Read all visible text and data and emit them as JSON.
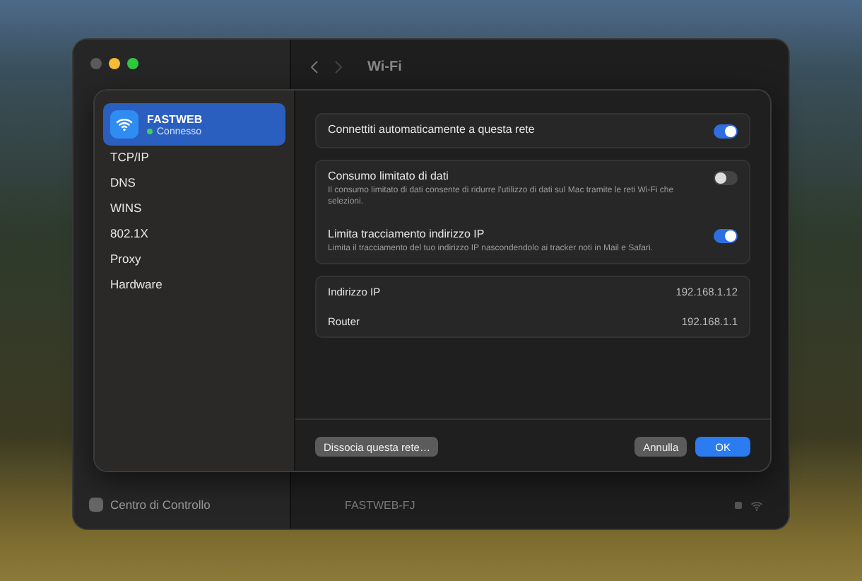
{
  "window": {
    "title": "Wi-Fi"
  },
  "background_sidebar": [
    {
      "label": "Centro di Controllo"
    }
  ],
  "background_networks": [
    {
      "name": "FASTWEB-FJ"
    }
  ],
  "sheet": {
    "network": {
      "name": "FASTWEB",
      "status": "Connesso",
      "selected": true
    },
    "nav": [
      {
        "label": "TCP/IP",
        "selected": false
      },
      {
        "label": "DNS",
        "selected": false
      },
      {
        "label": "WINS",
        "selected": false
      },
      {
        "label": "802.1X",
        "selected": false
      },
      {
        "label": "Proxy",
        "selected": false
      },
      {
        "label": "Hardware",
        "selected": false
      }
    ],
    "toggle_groups": [
      [
        {
          "title": "Connettiti automaticamente a questa rete",
          "on": true
        }
      ],
      [
        {
          "title": "Consumo limitato di dati",
          "description": "Il consumo limitato di dati consente di ridurre l'utilizzo di dati sul Mac tramite le reti Wi-Fi che selezioni.",
          "on": false
        },
        {
          "title": "Limita tracciamento indirizzo IP",
          "description": "Limita il tracciamento del tuo indirizzo IP nascondendolo ai tracker noti in Mail e Safari.",
          "on": true
        }
      ]
    ],
    "info": [
      {
        "label": "Indirizzo IP",
        "value": "192.168.1.12"
      },
      {
        "label": "Router",
        "value": "192.168.1.1"
      }
    ],
    "buttons": [
      {
        "label": "Dissocia questa rete…",
        "kind": "secondary"
      },
      {
        "label": "Annulla",
        "kind": "secondary"
      },
      {
        "label": "OK",
        "kind": "primary"
      }
    ]
  }
}
